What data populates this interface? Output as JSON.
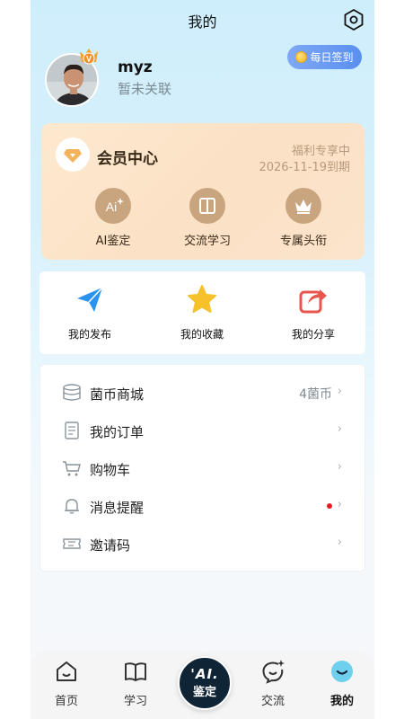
{
  "header": {
    "title": "我的"
  },
  "profile": {
    "username": "myz",
    "status": "暂未关联",
    "checkin_label": "每日签到"
  },
  "vip": {
    "title": "会员中心",
    "benefit": "福利专享中",
    "expire": "2026-11-19到期",
    "features": [
      {
        "icon": "ai-icon",
        "label": "AI鉴定"
      },
      {
        "icon": "book-icon",
        "label": "交流学习"
      },
      {
        "icon": "crown-icon",
        "label": "专属头衔"
      }
    ]
  },
  "actions": [
    {
      "icon": "paper-plane-icon",
      "label": "我的发布"
    },
    {
      "icon": "star-icon",
      "label": "我的收藏"
    },
    {
      "icon": "share-icon",
      "label": "我的分享"
    }
  ],
  "menu": [
    {
      "icon": "coins-icon",
      "label": "菌币商城",
      "value": "4菌币"
    },
    {
      "icon": "order-icon",
      "label": "我的订单",
      "value": ""
    },
    {
      "icon": "cart-icon",
      "label": "购物车",
      "value": ""
    },
    {
      "icon": "bell-icon",
      "label": "消息提醒",
      "value": "",
      "badge": true
    },
    {
      "icon": "ticket-icon",
      "label": "邀请码",
      "value": ""
    }
  ],
  "tabbar": {
    "home": "首页",
    "study": "学习",
    "center_line1": "'AI.",
    "center_line2": "鉴定",
    "exchange": "交流",
    "mine": "我的"
  },
  "colors": {
    "accent_blue": "#5a8ff0",
    "vip_gold": "#c9a57f",
    "badge_red": "#e11d24"
  }
}
